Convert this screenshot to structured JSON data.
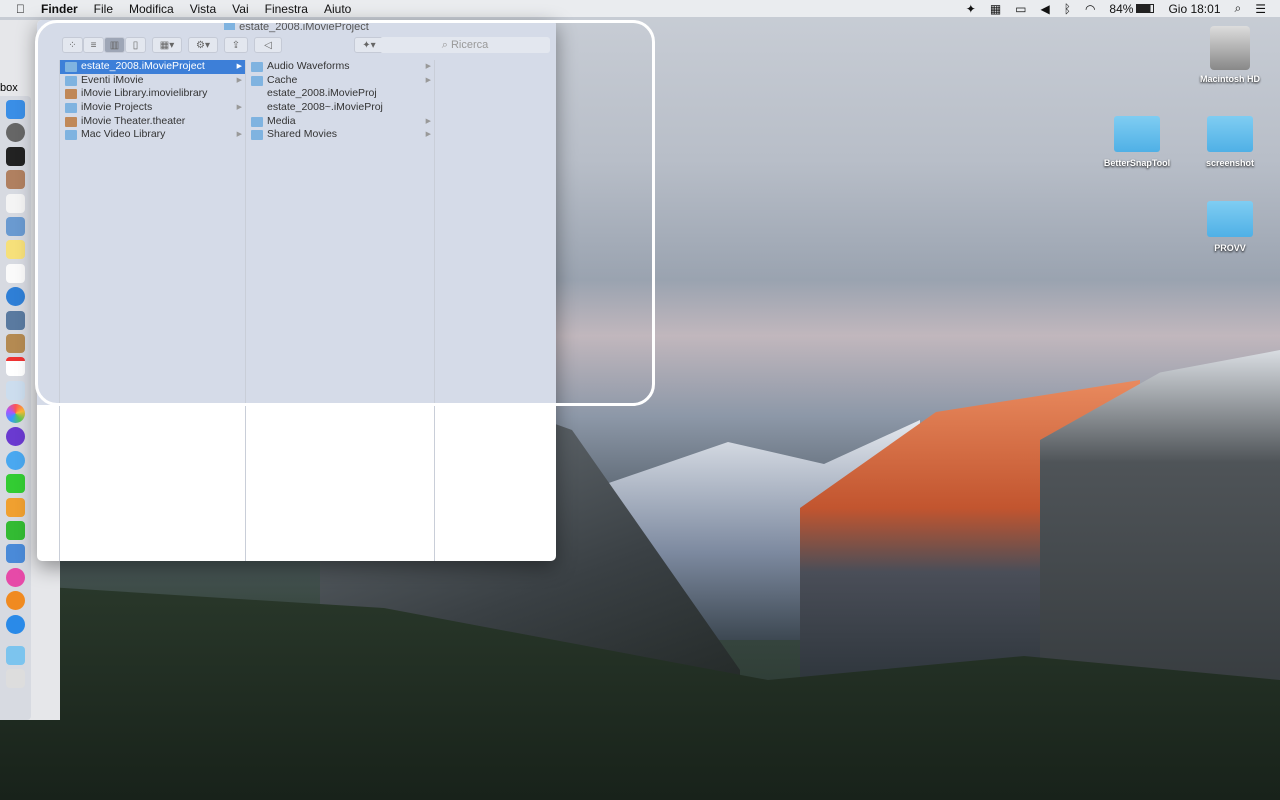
{
  "menubar": {
    "apple": "",
    "app": "Finder",
    "items": [
      "File",
      "Modifica",
      "Vista",
      "Vai",
      "Finestra",
      "Aiuto"
    ],
    "battery": "84%",
    "clock": "Gio 18:01"
  },
  "behind": {
    "text": "box"
  },
  "window": {
    "title": "estate_2008.iMovieProject",
    "search_placeholder": "Ricerca",
    "col1": [
      {
        "label": "estate_2008.iMovieProject",
        "selected": true,
        "arrow": true
      },
      {
        "label": "Eventi iMovie",
        "arrow": true
      },
      {
        "label": "iMovie Library.imovielibrary",
        "arrow": false
      },
      {
        "label": "iMovie Projects",
        "arrow": true
      },
      {
        "label": "iMovie Theater.theater",
        "arrow": false
      },
      {
        "label": "Mac Video Library",
        "arrow": true
      }
    ],
    "col2": [
      {
        "label": "Audio Waveforms",
        "arrow": true
      },
      {
        "label": "Cache",
        "arrow": true
      },
      {
        "label": "estate_2008.iMovieProj",
        "arrow": false
      },
      {
        "label": "estate_2008~.iMovieProj",
        "arrow": false
      },
      {
        "label": "Media",
        "arrow": true
      },
      {
        "label": "Shared Movies",
        "arrow": true
      }
    ]
  },
  "desktop": {
    "icons": [
      "Macintosh HD",
      "BetterSnapTool",
      "screenshot",
      "PROVV"
    ]
  }
}
